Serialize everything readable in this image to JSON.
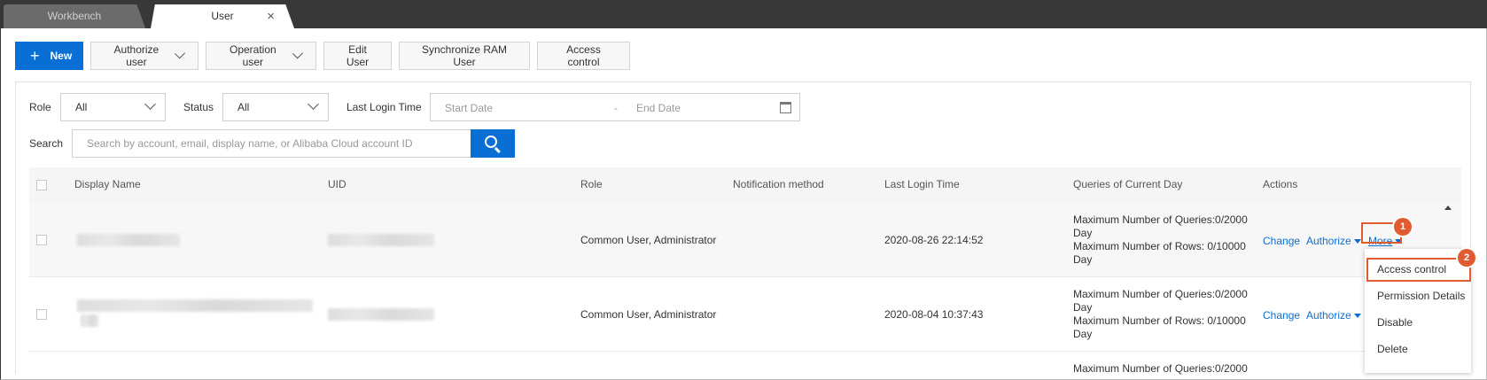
{
  "tabs": [
    {
      "label": "Workbench",
      "active": false
    },
    {
      "label": "User",
      "active": true,
      "close_icon": "×"
    }
  ],
  "toolbar": {
    "new_label": "New",
    "authorize_user_label": "Authorize user",
    "operation_user_label": "Operation user",
    "edit_user_label": "Edit User",
    "sync_ram_label": "Synchronize RAM User",
    "access_control_label": "Access control"
  },
  "filters": {
    "role_label": "Role",
    "role_value": "All",
    "status_label": "Status",
    "status_value": "All",
    "last_login_label": "Last Login Time",
    "start_placeholder": "Start Date",
    "date_sep": "-",
    "end_placeholder": "End Date",
    "search_label": "Search",
    "search_placeholder": "Search by account, email, display name, or Alibaba Cloud account ID"
  },
  "table": {
    "columns": [
      "Display Name",
      "UID",
      "Role",
      "Notification method",
      "Last Login Time",
      "Queries of Current Day",
      "Actions"
    ],
    "rows": [
      {
        "role": "Common User, Administrator",
        "last_login": "2020-08-26 22:14:52",
        "quota_queries": "Maximum Number of Queries:0/2000 Day",
        "quota_rows": "Maximum Number of Rows: 0/10000 Day",
        "change": "Change",
        "authorize": "Authorize",
        "more": "More"
      },
      {
        "role": "Common User, Administrator",
        "last_login": "2020-08-04 10:37:43",
        "quota_queries": "Maximum Number of Queries:0/2000 Day",
        "quota_rows": "Maximum Number of Rows: 0/10000 Day",
        "change": "Change",
        "authorize": "Authorize"
      },
      {
        "quota_queries": "Maximum Number of Queries:0/2000"
      }
    ]
  },
  "more_menu": [
    "Access control",
    "Permission Details",
    "Disable",
    "Delete"
  ],
  "annotations": [
    "1",
    "2"
  ],
  "colors": {
    "primary": "#0a6fd4",
    "highlight": "#e05b32"
  }
}
